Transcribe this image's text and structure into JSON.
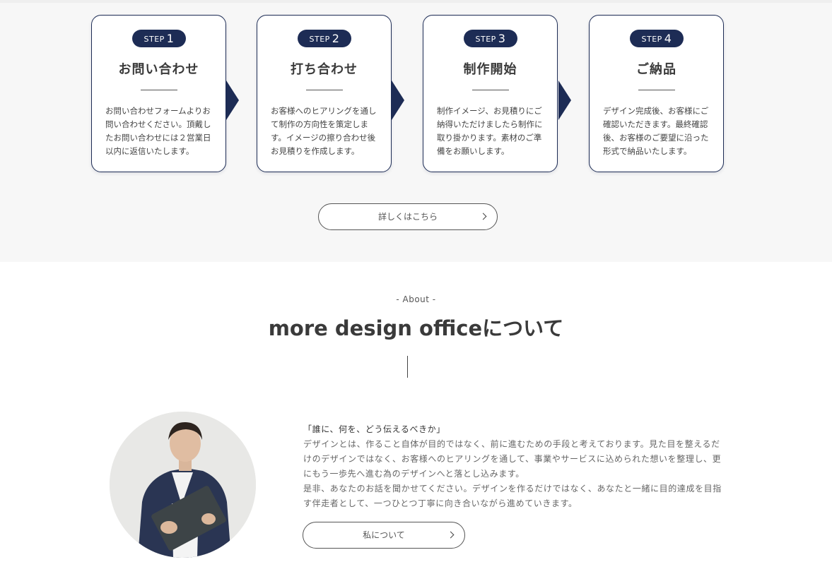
{
  "steps": [
    {
      "badge": "STEP",
      "num": "1",
      "title": "お問い合わせ",
      "desc": "お問い合わせフォームよりお問い合わせください。頂戴したお問い合わせには２営業日以内に返信いたします。"
    },
    {
      "badge": "STEP",
      "num": "2",
      "title": "打ち合わせ",
      "desc": "お客様へのヒアリングを通して制作の方向性を策定します。イメージの擦り合わせ後お見積りを作成します。"
    },
    {
      "badge": "STEP",
      "num": "3",
      "title": "制作開始",
      "desc": "制作イメージ、お見積りにご納得いただけましたら制作に取り掛かります。素材のご準備をお願いします。"
    },
    {
      "badge": "STEP",
      "num": "4",
      "title": "ご納品",
      "desc": "デザイン完成後、お客様にご確認いただきます。最終確認後、お客様のご要望に沿った形式で納品いたします。"
    }
  ],
  "steps_button": {
    "label": "詳しくはこちら"
  },
  "about": {
    "eyebrow": "- About -",
    "heading": "more design officeについて",
    "quote": "「誰に、何を、どう伝えるべきか」",
    "paragraph1": "デザインとは、作ること自体が目的ではなく、前に進むための手段と考えております。見た目を整えるだけのデザインではなく、お客様へのヒアリングを通して、事業やサービスに込められた想いを整理し、更にもう一歩先へ進む為のデザインへと落とし込みます。",
    "paragraph2": "是非、あなたのお話を聞かせてください。デザインを作るだけではなく、あなたと一緒に目的達成を目指す伴走者として、一つひとつ丁寧に向き合いながら進めていきます。",
    "button_label": "私について"
  },
  "icons": {
    "chevron": "chevron-right-icon",
    "step_arrow": "triangle-right-icon"
  },
  "colors": {
    "navy": "#1d2c55",
    "section_bg": "#f7f7f7"
  }
}
